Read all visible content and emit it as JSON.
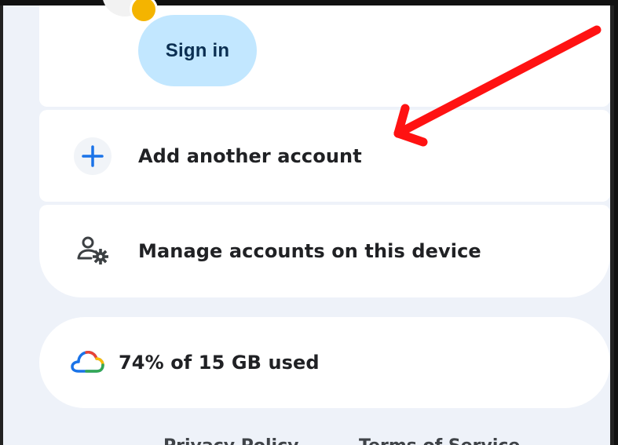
{
  "account": {
    "sign_in_label": "Sign in"
  },
  "menu": {
    "add_account_label": "Add another account",
    "manage_accounts_label": "Manage accounts on this device"
  },
  "storage": {
    "usage_label": "74% of 15 GB used",
    "used_percent": 74,
    "total_storage": "15 GB"
  },
  "footer": {
    "privacy_label": "Privacy Policy",
    "terms_label": "Terms of Service"
  },
  "colors": {
    "panel_background": "#eef2f9",
    "card_background": "#ffffff",
    "sign_in_background": "#c2e7ff",
    "primary_icon": "#1a73e8",
    "annotation_arrow": "#ff1212"
  },
  "icons": {
    "add": "plus-icon",
    "manage": "manage-accounts-icon",
    "storage": "cloud-icon"
  }
}
